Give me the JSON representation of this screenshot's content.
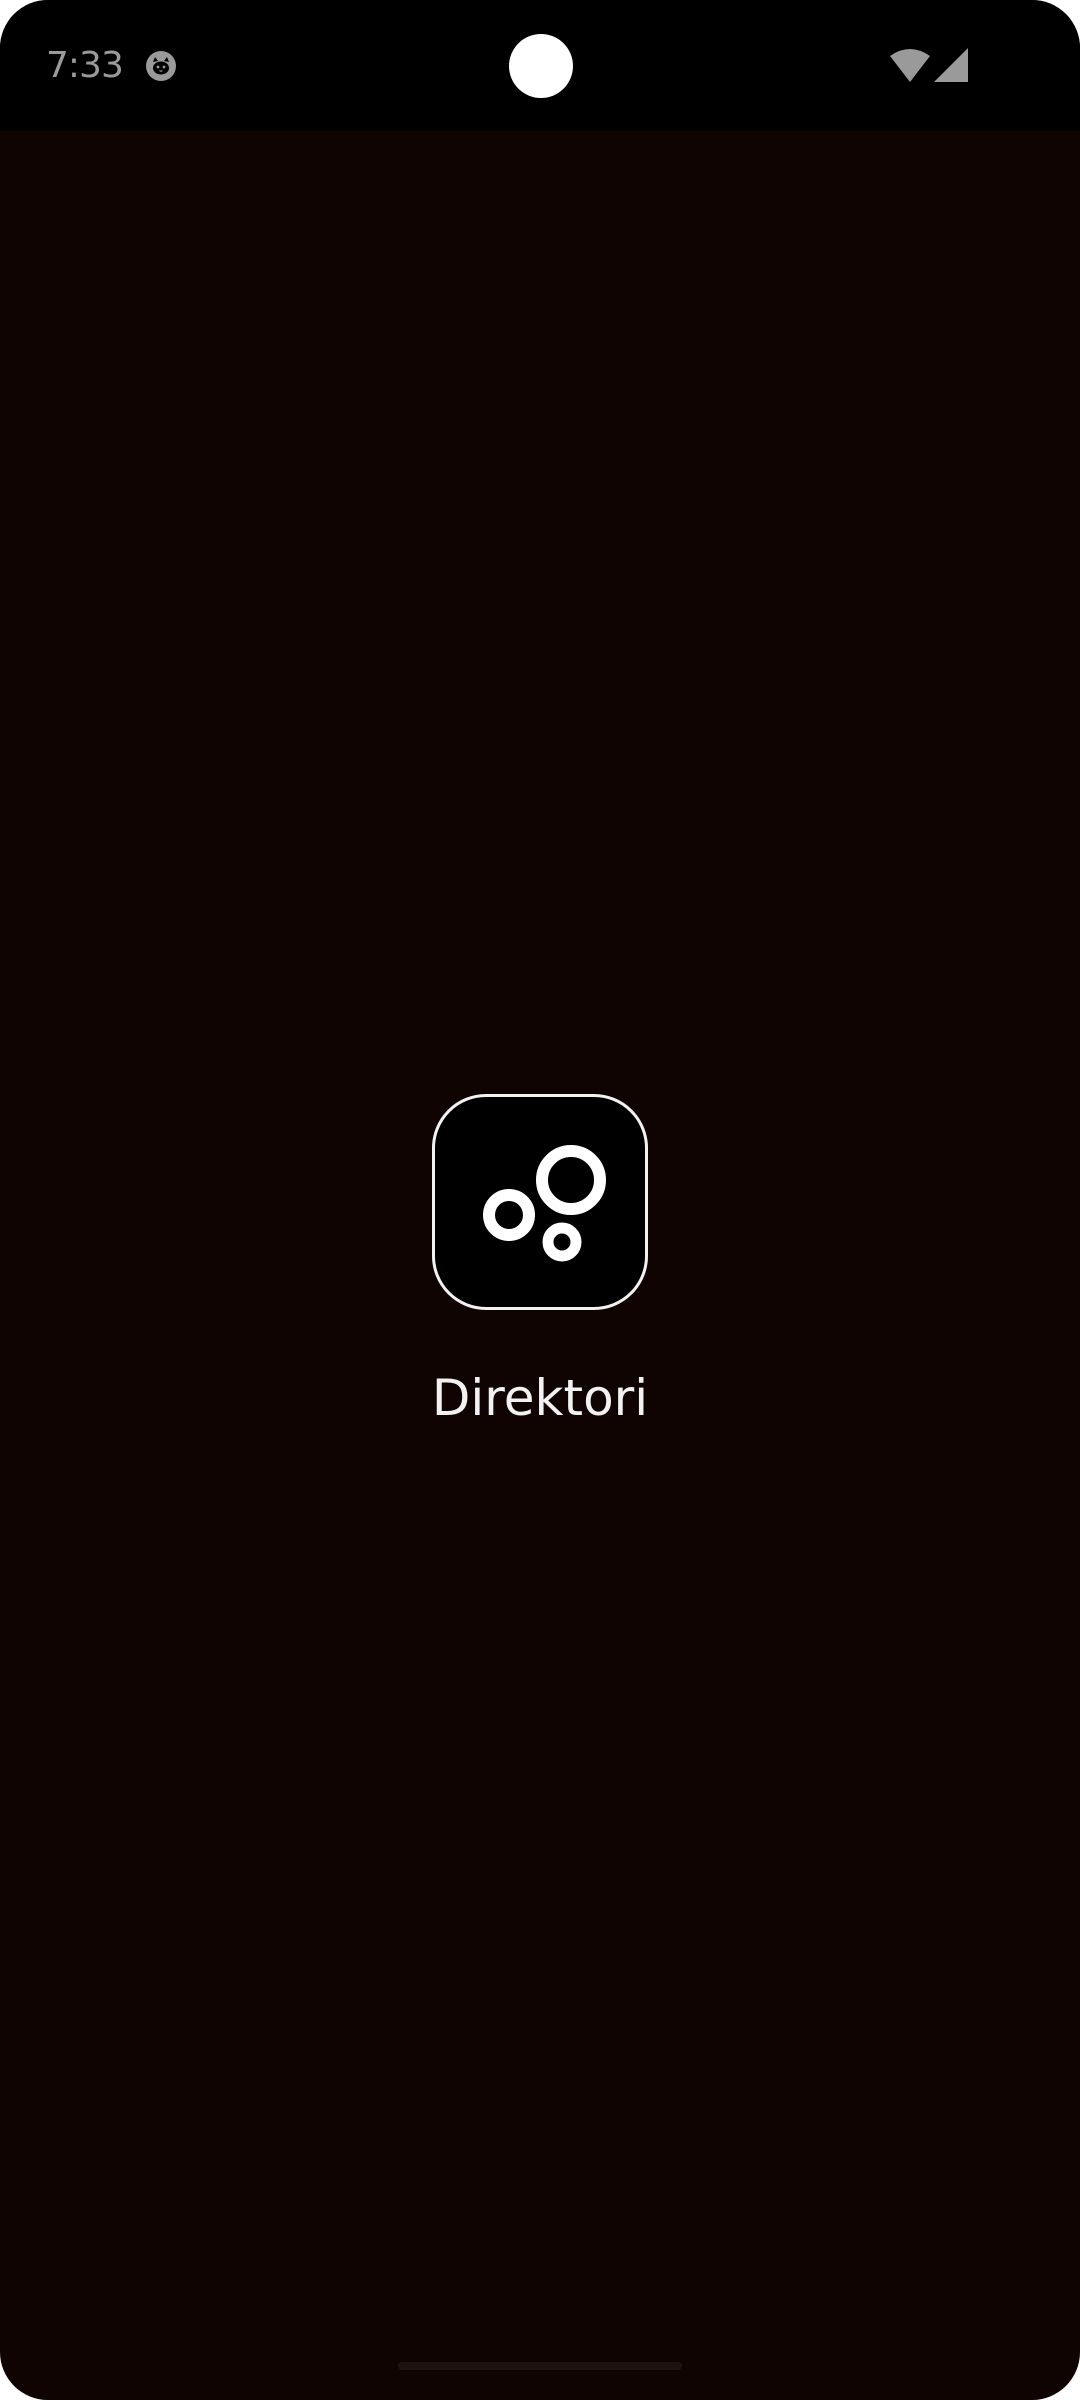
{
  "status_bar": {
    "time": "7:33",
    "icons": [
      "cat-notification-icon",
      "wifi-icon",
      "cellular-signal-icon"
    ]
  },
  "splash": {
    "app_name": "Direktori",
    "logo_icon": "bubbles-logo-icon"
  },
  "colors": {
    "background": "#0f0402",
    "status_bar": "#000000",
    "foreground": "#f2f2f2",
    "status_icons": "#9a9a9a"
  }
}
